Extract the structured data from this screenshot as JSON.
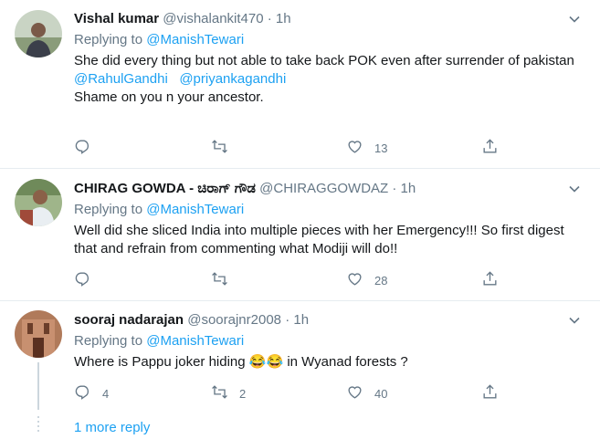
{
  "replies": [
    {
      "name": "Vishal kumar",
      "handle": "@vishalankit470",
      "dot": "·",
      "time": "1h",
      "replying_label": "Replying to",
      "replying_to": "@ManishTewari",
      "body_line1": "She did every thing but not able to take back POK even after surrender of pakistan",
      "mention1": "@RahulGandhi",
      "mention2": "@priyankagandhi",
      "body_line3": "Shame on you n your ancestor.",
      "reply_count": "",
      "retweet_count": "",
      "like_count": "13"
    },
    {
      "name": "CHIRAG GOWDA - ಚಿರಾಗ್ ಗೌಡ",
      "handle": "@CHIRAGGOWDAZ",
      "dot": "·",
      "time": "1h",
      "replying_label": "Replying to",
      "replying_to": "@ManishTewari",
      "body": "Well did she sliced India into multiple pieces with her Emergency!!! So first digest that and refrain from commenting what Modiji will do!!",
      "reply_count": "",
      "retweet_count": "",
      "like_count": "28"
    },
    {
      "name": "sooraj nadarajan",
      "handle": "@soorajnr2008",
      "dot": "·",
      "time": "1h",
      "replying_label": "Replying to",
      "replying_to": "@ManishTewari",
      "body_pre": "Where is Pappu joker hiding",
      "body_emoji": "😂😂",
      "body_post": "in Wyanad forests ?",
      "reply_count": "4",
      "retweet_count": "2",
      "like_count": "40"
    }
  ],
  "more_replies": "1 more reply",
  "icons": [
    "chevron-down-icon",
    "reply-icon",
    "retweet-icon",
    "like-icon",
    "share-icon"
  ],
  "colors": {
    "link": "#1da1f2",
    "muted": "#657786",
    "text": "#14171a",
    "divider": "#e6ecf0"
  }
}
